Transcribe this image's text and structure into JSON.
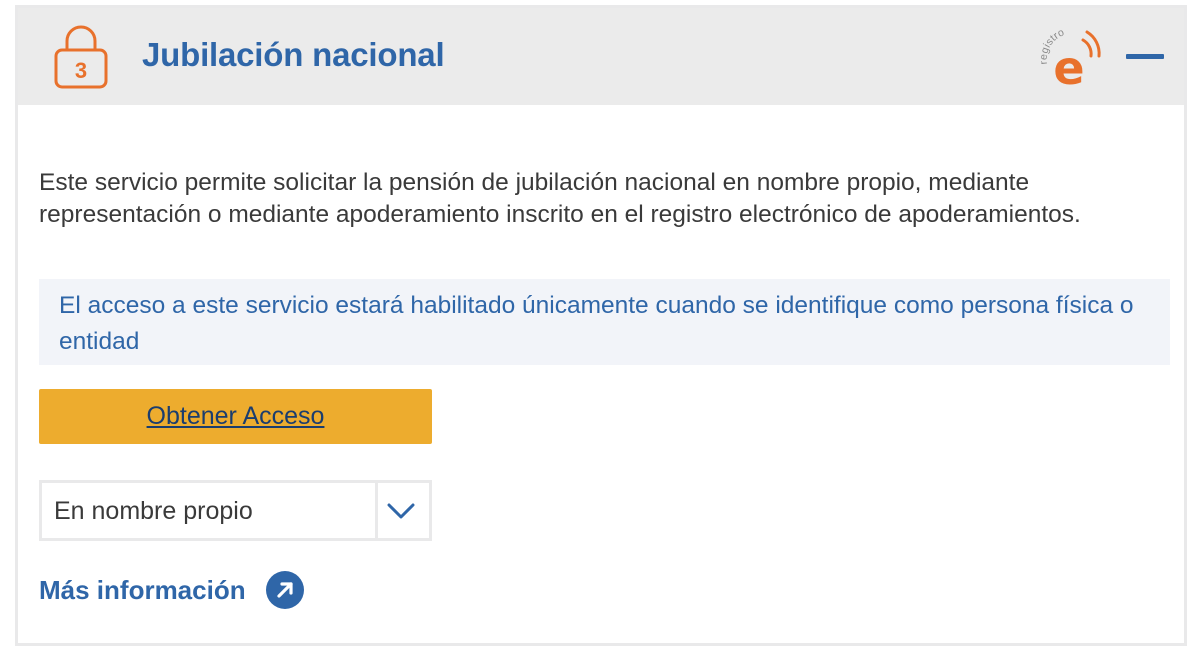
{
  "header": {
    "step_number": "3",
    "title": "Jubilación nacional",
    "logo_arc_text": "registro",
    "logo_letter": "e",
    "icons": {
      "lock": "lock-icon",
      "logo": "registro-e-logo",
      "collapse": "minus-icon"
    }
  },
  "body": {
    "description": "Este servicio permite solicitar la pensión de jubilación nacional en nombre propio, mediante representación o mediante apoderamiento inscrito en el registro electrónico de apoderamientos.",
    "notice": "El acceso a este servicio estará habilitado únicamente cuando se identifique como persona física o entidad",
    "access_button_label": "Obtener Acceso",
    "select": {
      "selected": "En nombre propio",
      "icon": "chevron-down-icon"
    },
    "more_info": {
      "label": "Más información",
      "icon": "arrow-up-right-circle-icon"
    }
  },
  "colors": {
    "title_blue": "#2f66a8",
    "header_bg": "#ebebeb",
    "accent_orange": "#e8712c",
    "button_yellow": "#edac2e",
    "notice_bg": "#f2f4f9",
    "body_text": "#3a3a3a"
  }
}
